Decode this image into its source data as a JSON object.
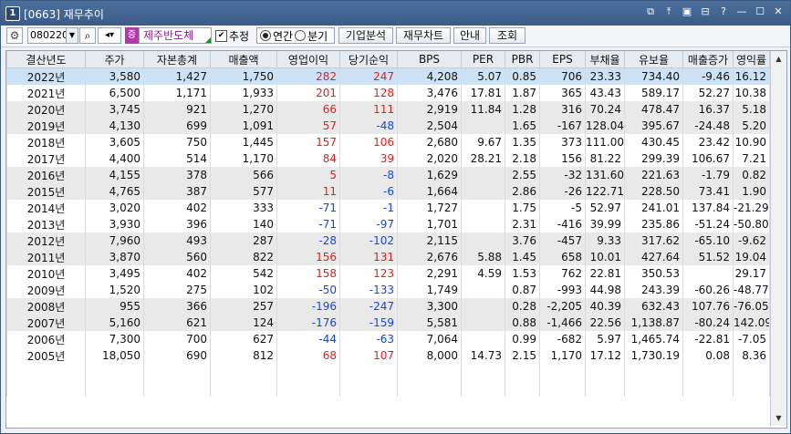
{
  "window": {
    "screen_no": "1",
    "title": "[0663] 재무추이",
    "icons": [
      "link-icon",
      "pin-icon",
      "save-icon",
      "print-icon",
      "help-icon",
      "minimize-icon",
      "maximize-icon",
      "close-icon"
    ]
  },
  "toolbar": {
    "code": "080220",
    "stock_badge": "증",
    "stock_name": "제주반도체",
    "estimate_label": "추정",
    "estimate_checked": true,
    "period_annual_label": "연간",
    "period_quarter_label": "분기",
    "period_selected": "연간",
    "btn_company": "기업분석",
    "btn_fchart": "재무차트",
    "btn_guide": "안내",
    "btn_query": "조회"
  },
  "table": {
    "headers": [
      "결산년도",
      "주가",
      "자본총계",
      "매출액",
      "영업이익",
      "당기순익",
      "BPS",
      "PER",
      "PBR",
      "EPS",
      "부채율",
      "유보율",
      "매출증가",
      "영익률"
    ],
    "rows": [
      [
        "2022년",
        "3,580",
        "1,427",
        "1,750",
        "282",
        "247",
        "4,208",
        "5.07",
        "0.85",
        "706",
        "23.33",
        "734.40",
        "-9.46",
        "16.12"
      ],
      [
        "2021년",
        "6,500",
        "1,171",
        "1,933",
        "201",
        "128",
        "3,476",
        "17.81",
        "1.87",
        "365",
        "43.43",
        "589.17",
        "52.27",
        "10.38"
      ],
      [
        "2020년",
        "3,745",
        "921",
        "1,270",
        "66",
        "111",
        "2,919",
        "11.84",
        "1.28",
        "316",
        "70.24",
        "478.47",
        "16.37",
        "5.18"
      ],
      [
        "2019년",
        "4,130",
        "699",
        "1,091",
        "57",
        "-48",
        "2,504",
        "",
        "1.65",
        "-167",
        "128.04",
        "395.67",
        "-24.48",
        "5.20"
      ],
      [
        "2018년",
        "3,605",
        "750",
        "1,445",
        "157",
        "106",
        "2,680",
        "9.67",
        "1.35",
        "373",
        "111.00",
        "430.45",
        "23.42",
        "10.90"
      ],
      [
        "2017년",
        "4,400",
        "514",
        "1,170",
        "84",
        "39",
        "2,020",
        "28.21",
        "2.18",
        "156",
        "81.22",
        "299.39",
        "106.67",
        "7.21"
      ],
      [
        "2016년",
        "4,155",
        "378",
        "566",
        "5",
        "-8",
        "1,629",
        "",
        "2.55",
        "-32",
        "131.60",
        "221.63",
        "-1.79",
        "0.82"
      ],
      [
        "2015년",
        "4,765",
        "387",
        "577",
        "11",
        "-6",
        "1,664",
        "",
        "2.86",
        "-26",
        "122.71",
        "228.50",
        "73.41",
        "1.90"
      ],
      [
        "2014년",
        "3,020",
        "402",
        "333",
        "-71",
        "-1",
        "1,727",
        "",
        "1.75",
        "-5",
        "52.97",
        "241.01",
        "137.84",
        "-21.29"
      ],
      [
        "2013년",
        "3,930",
        "396",
        "140",
        "-71",
        "-97",
        "1,701",
        "",
        "2.31",
        "-416",
        "39.99",
        "235.86",
        "-51.24",
        "-50.80"
      ],
      [
        "2012년",
        "7,960",
        "493",
        "287",
        "-28",
        "-102",
        "2,115",
        "",
        "3.76",
        "-457",
        "9.33",
        "317.62",
        "-65.10",
        "-9.62"
      ],
      [
        "2011년",
        "3,870",
        "560",
        "822",
        "156",
        "131",
        "2,676",
        "5.88",
        "1.45",
        "658",
        "10.01",
        "427.64",
        "51.52",
        "19.04"
      ],
      [
        "2010년",
        "3,495",
        "402",
        "542",
        "158",
        "123",
        "2,291",
        "4.59",
        "1.53",
        "762",
        "22.81",
        "350.53",
        "",
        "29.17"
      ],
      [
        "2009년",
        "1,520",
        "275",
        "102",
        "-50",
        "-133",
        "1,749",
        "",
        "0.87",
        "-993",
        "44.98",
        "243.39",
        "-60.26",
        "-48.77"
      ],
      [
        "2008년",
        "955",
        "366",
        "257",
        "-196",
        "-247",
        "3,300",
        "",
        "0.28",
        "-2,205",
        "40.39",
        "632.43",
        "107.76",
        "-76.05"
      ],
      [
        "2007년",
        "5,160",
        "621",
        "124",
        "-176",
        "-159",
        "5,581",
        "",
        "0.88",
        "-1,466",
        "22.56",
        "1,138.87",
        "-80.24",
        "142.09"
      ],
      [
        "2006년",
        "7,300",
        "700",
        "627",
        "-44",
        "-63",
        "7,064",
        "",
        "0.99",
        "-682",
        "5.97",
        "1,465.74",
        "-22.81",
        "-7.05"
      ],
      [
        "2005년",
        "18,050",
        "690",
        "812",
        "68",
        "107",
        "8,000",
        "14.73",
        "2.15",
        "1,170",
        "17.12",
        "1,730.19",
        "0.08",
        "8.36"
      ]
    ],
    "row_shades": [
      "sel",
      "white",
      "gray",
      "gray",
      "white",
      "white",
      "gray",
      "gray",
      "white",
      "white",
      "gray",
      "gray",
      "white",
      "white",
      "gray",
      "gray",
      "white",
      "white"
    ],
    "empty_rows": 2
  }
}
